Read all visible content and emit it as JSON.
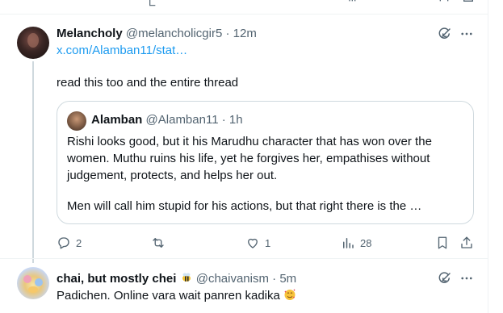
{
  "tweet1": {
    "name": "Melancholy",
    "handle": "@melancholicgir5",
    "dot": "·",
    "time": "12m",
    "link": "x.com/Alamban11/stat…",
    "text": "read this too and the entire thread"
  },
  "quote": {
    "name": "Alamban",
    "handle": "@Alamban11",
    "dot": "·",
    "time": "1h",
    "lines": [
      "Rishi looks good, but it his Marudhu character that has won over the",
      "women. Muthu ruins his life, yet he forgives her, empathises without",
      "judgement, protects, and helps her out.",
      "",
      "Men will call him stupid for his actions, but that right there is the …"
    ]
  },
  "actions": {
    "replies": "2",
    "retweets": "",
    "likes": "1",
    "views": "28"
  },
  "tweet2": {
    "name": "chai, but mostly chei",
    "handle": "@chaivanism",
    "dot": "·",
    "time": "5m",
    "text": "Padichen. Online vara wait panren kadika"
  },
  "icons": {
    "grok": "grok-icon",
    "more": "more-icon",
    "reply": "reply-icon",
    "retweet": "retweet-icon",
    "like": "heart-icon",
    "views": "views-icon",
    "bookmark": "bookmark-icon",
    "share": "share-icon",
    "bee_emoji": "bee-emoji",
    "love_emoji": "smiling-face-with-hearts-emoji"
  },
  "colors": {
    "text": "#0f1419",
    "muted": "#536471",
    "link": "#1d9bf0",
    "border": "#cfd9de"
  }
}
